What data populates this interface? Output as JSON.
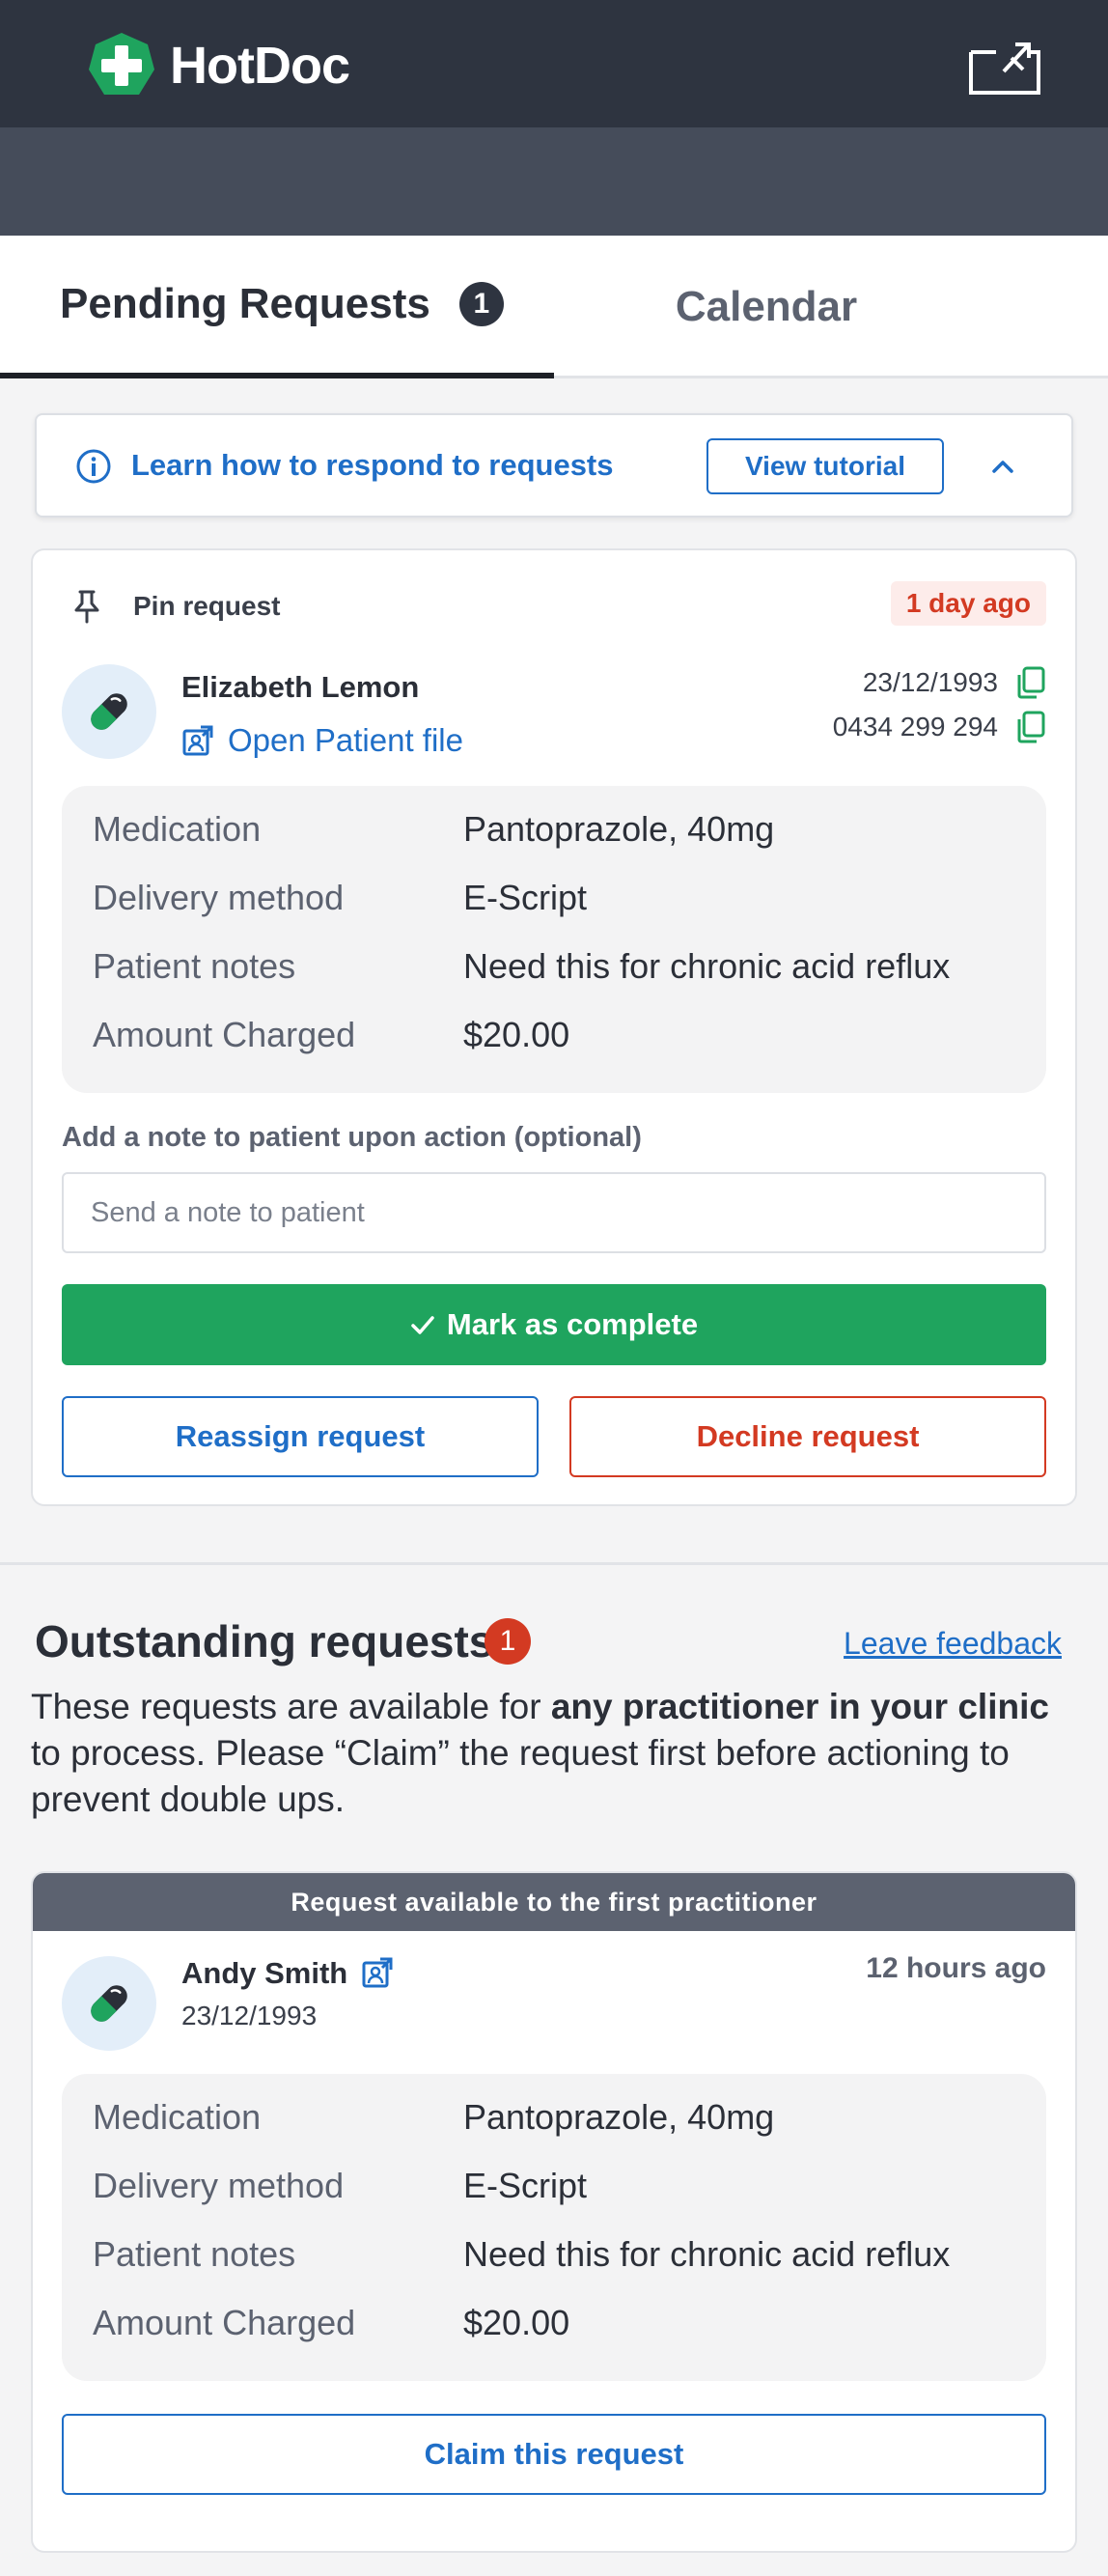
{
  "app": {
    "brand": "HotDoc"
  },
  "colors": {
    "header_bg": "#2e3440",
    "accent_blue": "#1f6ec7",
    "success_green": "#1fa45e",
    "danger_red": "#d33a22"
  },
  "tabs": [
    {
      "label": "Pending Requests",
      "badge": "1",
      "active": true
    },
    {
      "label": "Calendar",
      "active": false
    }
  ],
  "tutorial": {
    "text": "Learn how to respond to requests",
    "button": "View tutorial"
  },
  "pending_request": {
    "pin_label": "Pin request",
    "age": "1 day ago",
    "patient_name": "Elizabeth Lemon",
    "open_file": "Open Patient file",
    "dob": "23/12/1993",
    "phone": "0434 299 294",
    "details": [
      {
        "label": "Medication",
        "value": "Pantoprazole, 40mg"
      },
      {
        "label": "Delivery method",
        "value": "E-Script"
      },
      {
        "label": "Patient notes",
        "value": "Need this for chronic acid reflux"
      },
      {
        "label": "Amount Charged",
        "value": "$20.00"
      }
    ],
    "note_label": "Add a note to patient upon action (optional)",
    "note_placeholder": "Send a note to patient",
    "complete_button": "Mark as complete",
    "reassign_button": "Reassign request",
    "decline_button": "Decline request"
  },
  "outstanding": {
    "title": "Outstanding requests",
    "badge": "1",
    "feedback_link": "Leave feedback",
    "desc_part1": "These requests are available for ",
    "desc_bold": "any practitioner in your clinic",
    "desc_part2": " to process. Please “Claim” the request first before actioning to prevent double ups.",
    "request": {
      "banner": "Request available to the first practitioner",
      "patient_name": "Andy Smith",
      "dob": "23/12/1993",
      "age": "12 hours ago",
      "details": [
        {
          "label": "Medication",
          "value": "Pantoprazole, 40mg"
        },
        {
          "label": "Delivery method",
          "value": "E-Script"
        },
        {
          "label": "Patient notes",
          "value": "Need this for chronic acid reflux"
        },
        {
          "label": "Amount Charged",
          "value": "$20.00"
        }
      ],
      "claim_button": "Claim this request"
    }
  }
}
